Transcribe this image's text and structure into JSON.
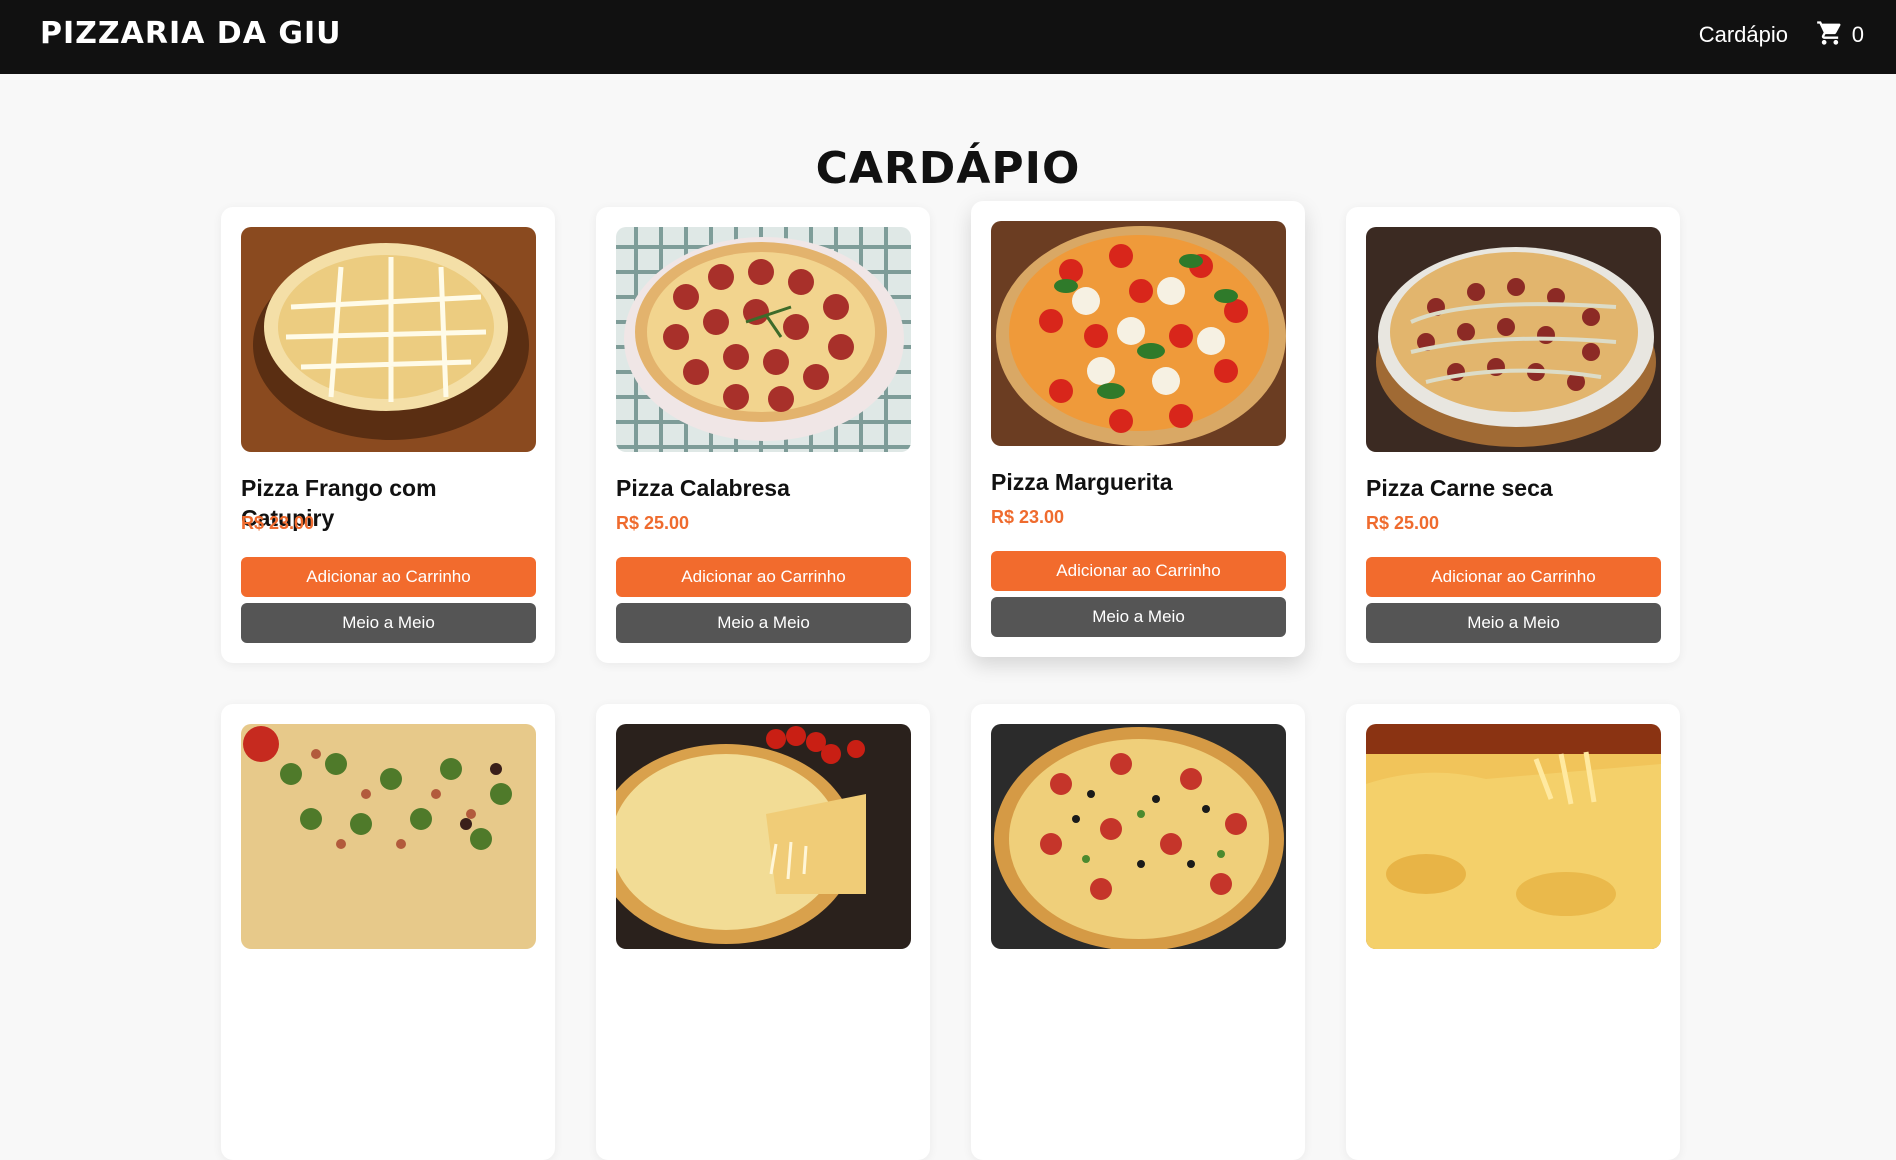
{
  "header": {
    "brand": "Pizzaria da Giu",
    "nav_menu": "Cardápio",
    "cart_count": "0"
  },
  "page": {
    "title": "Cardápio"
  },
  "colors": {
    "navbar": "#111111",
    "accent": "#f26b2d",
    "price": "#ef6b2e",
    "secondary_button": "#555555",
    "background": "#f8f8f8"
  },
  "icons": {
    "cart": "shopping-cart-icon"
  },
  "products": [
    {
      "name": "Pizza Frango com Catupiry",
      "price": "R$ 23.00",
      "add_label": "Adicionar ao Carrinho",
      "half_label": "Meio a Meio"
    },
    {
      "name": "Pizza Calabresa",
      "price": "R$ 25.00",
      "add_label": "Adicionar ao Carrinho",
      "half_label": "Meio a Meio"
    },
    {
      "name": "Pizza Marguerita",
      "price": "R$ 23.00",
      "add_label": "Adicionar ao Carrinho",
      "half_label": "Meio a Meio"
    },
    {
      "name": "Pizza Carne seca",
      "price": "R$ 25.00",
      "add_label": "Adicionar ao Carrinho",
      "half_label": "Meio a Meio"
    },
    {
      "name": "",
      "price": ""
    },
    {
      "name": "",
      "price": ""
    },
    {
      "name": "",
      "price": ""
    },
    {
      "name": "",
      "price": ""
    }
  ]
}
